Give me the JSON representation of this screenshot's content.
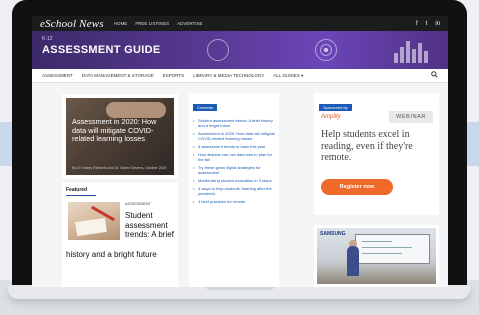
{
  "top_bar": {
    "logo": "eSchool News",
    "links": [
      "HOME",
      "FREE LISTINGS",
      "ADVERTISE"
    ],
    "social": [
      "f",
      "t",
      "in"
    ]
  },
  "hero": {
    "kicker": "K-12",
    "title": "ASSESSMENT GUIDE"
  },
  "nav": {
    "items": [
      "ASSESSMENT",
      "DATA MANAGEMENT & STORAGE",
      "ESPORTS",
      "LIBRARY & MEDIA TECHNOLOGY",
      "ALL GUIDES ▾"
    ],
    "search_icon": "search-icon"
  },
  "main_article": {
    "title": "Assessment in 2020: How data will mitigate COVID-related learning losses",
    "byline": "By Dr. Kasey Richards and Dr. Karen Stevens, October 2020"
  },
  "featured": {
    "label": "Featured",
    "category": "ASSESSMENT",
    "title_lines": [
      "Student",
      "assessment",
      "trends: A brief"
    ],
    "title_last_line": "history and a bright future"
  },
  "contents": {
    "label": "Contents",
    "items": [
      "Student assessment trends: A brief history and a bright future",
      "Assessment in 2020: How data will mitigate COVID-related learning losses",
      "5 assessment trends to track this year",
      "How districts can use data now to plan for the fall",
      "Try these great digital strategies for assessment",
      "Modernizing student evaluation in 3 steps",
      "3 ways to help students' learning after the pandemic",
      "4 best practices for remote"
    ]
  },
  "sponsor": {
    "label": "Sponsored by",
    "brand": "Amplify",
    "webinar": "WEBINAR",
    "headline": "Help students excel in reading, even if they're remote.",
    "cta": "Register now"
  },
  "ad2": {
    "brand": "SAMSUNG"
  }
}
